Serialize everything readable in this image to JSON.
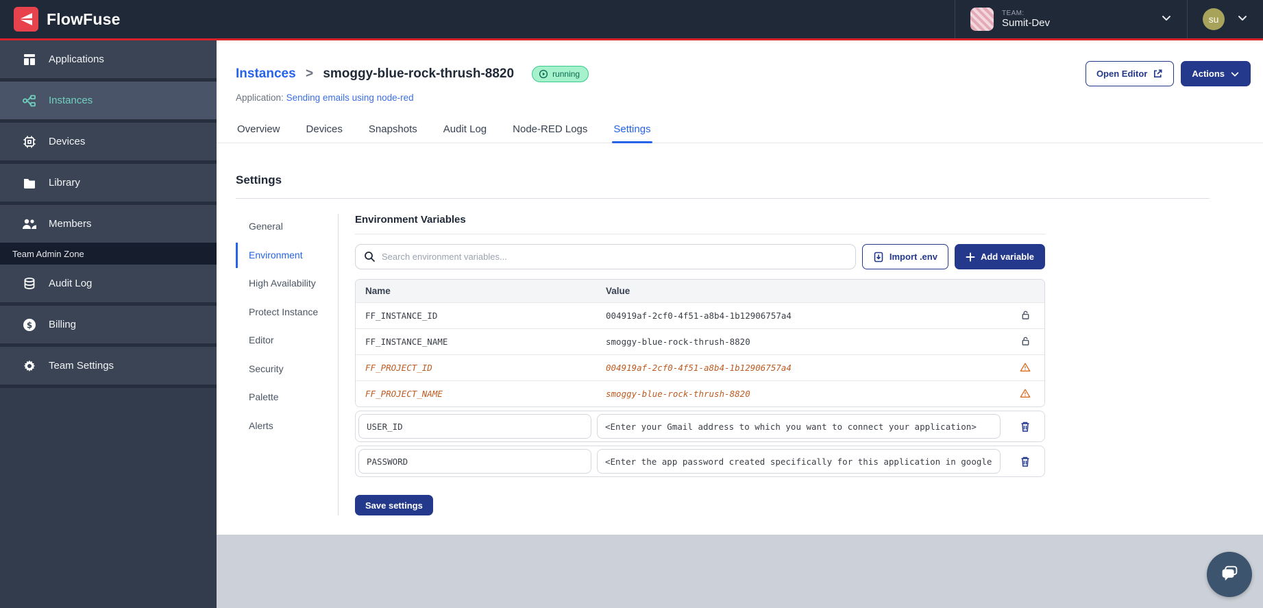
{
  "topbar": {
    "brand": "FlowFuse",
    "team_label": "TEAM:",
    "team_name": "Sumit-Dev",
    "user_initials": "su"
  },
  "sidebar": {
    "items": [
      {
        "label": "Applications"
      },
      {
        "label": "Instances"
      },
      {
        "label": "Devices"
      },
      {
        "label": "Library"
      },
      {
        "label": "Members"
      }
    ],
    "admin_zone_label": "Team Admin Zone",
    "admin_items": [
      {
        "label": "Audit Log"
      },
      {
        "label": "Billing"
      },
      {
        "label": "Team Settings"
      }
    ]
  },
  "header": {
    "breadcrumb_parent": "Instances",
    "breadcrumb_separator": ">",
    "instance_name": "smoggy-blue-rock-thrush-8820",
    "status_badge": "running",
    "application_label": "Application:",
    "application_link": "Sending emails using node-red",
    "open_editor_label": "Open Editor",
    "actions_label": "Actions"
  },
  "tabs": [
    {
      "label": "Overview"
    },
    {
      "label": "Devices"
    },
    {
      "label": "Snapshots"
    },
    {
      "label": "Audit Log"
    },
    {
      "label": "Node-RED Logs"
    },
    {
      "label": "Settings"
    }
  ],
  "settings": {
    "title": "Settings",
    "nav": [
      {
        "label": "General"
      },
      {
        "label": "Environment"
      },
      {
        "label": "High Availability"
      },
      {
        "label": "Protect Instance"
      },
      {
        "label": "Editor"
      },
      {
        "label": "Security"
      },
      {
        "label": "Palette"
      },
      {
        "label": "Alerts"
      }
    ],
    "env": {
      "title": "Environment Variables",
      "search_placeholder": "Search environment variables...",
      "import_label": "Import .env",
      "add_label": "Add variable",
      "save_label": "Save settings",
      "table": {
        "columns": [
          "Name",
          "Value"
        ],
        "rows": [
          {
            "name": "FF_INSTANCE_ID",
            "value": "004919af-2cf0-4f51-a8b4-1b12906757a4",
            "state": "locked"
          },
          {
            "name": "FF_INSTANCE_NAME",
            "value": "smoggy-blue-rock-thrush-8820",
            "state": "locked"
          },
          {
            "name": "FF_PROJECT_ID",
            "value": "004919af-2cf0-4f51-a8b4-1b12906757a4",
            "state": "deprecated"
          },
          {
            "name": "FF_PROJECT_NAME",
            "value": "smoggy-blue-rock-thrush-8820",
            "state": "deprecated"
          }
        ],
        "editable_rows": [
          {
            "name": "USER_ID",
            "value": "<Enter your Gmail address to which you want to connect your application>"
          },
          {
            "name": "PASSWORD",
            "value": "<Enter the app password created specifically for this application in google"
          }
        ]
      }
    }
  },
  "colors": {
    "accent_navy": "#24398b",
    "brand_red": "#e8434c",
    "topbar_red_line": "#d9222a",
    "link_blue": "#2563eb",
    "status_running_bg": "#a5f2cc",
    "status_running_text": "#0c6b4d",
    "deprecated_orange": "#be5b21",
    "sidebar_active_teal": "#6fd0bd"
  }
}
